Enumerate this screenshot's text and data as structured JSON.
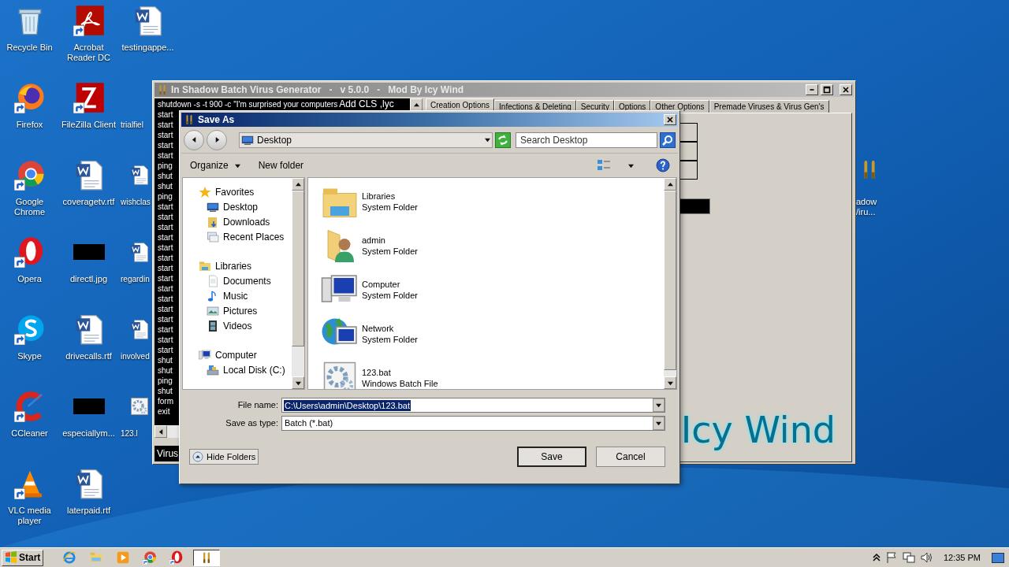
{
  "desktop_icons": [
    {
      "label": "Recycle Bin",
      "kind": "recycle"
    },
    {
      "label": "Firefox",
      "kind": "firefox"
    },
    {
      "label": "Google Chrome",
      "kind": "chrome"
    },
    {
      "label": "Opera",
      "kind": "opera"
    },
    {
      "label": "Skype",
      "kind": "skype"
    },
    {
      "label": "CCleaner",
      "kind": "ccleaner"
    },
    {
      "label": "VLC media player",
      "kind": "vlc"
    },
    {
      "label": "Acrobat Reader DC",
      "kind": "pdf"
    },
    {
      "label": "FileZilla Client",
      "kind": "filezilla"
    },
    {
      "label": "coveragetv.rtf",
      "kind": "word"
    },
    {
      "label": "directl.jpg",
      "kind": "image"
    },
    {
      "label": "drivecalls.rtf",
      "kind": "word"
    },
    {
      "label": "especiallym...",
      "kind": "image"
    },
    {
      "label": "laterpaid.rtf",
      "kind": "word"
    },
    {
      "label": "testingappe...",
      "kind": "word"
    },
    {
      "label": "trialfiel",
      "kind": "none"
    },
    {
      "label": "wishclas",
      "kind": "word"
    },
    {
      "label": "regardin",
      "kind": "word"
    },
    {
      "label": "involved",
      "kind": "word"
    },
    {
      "label": "123.l",
      "kind": "batch"
    }
  ],
  "side_icon": {
    "label": "adow /iru...",
    "kind": "bullets"
  },
  "app_window": {
    "title": "In Shadow Batch Virus Generator   -   v 5.0.0   -   Mod By Icy Wind",
    "active": false,
    "code_lines": [
      "shutdown -s -t 900 -c \"I'm surprised your computers",
      "start",
      "start",
      "start",
      "start",
      "start",
      "ping",
      "shut",
      "shut",
      "ping",
      "start",
      "start",
      "start",
      "start",
      "start",
      "start",
      "start",
      "start",
      "start",
      "start",
      "start",
      "start",
      "start",
      "start",
      "start",
      "shut",
      "shut",
      "ping",
      "shut",
      "form",
      "exit"
    ],
    "overlay_label": "Add CLS ,lyc",
    "status_label": "Virus",
    "tabs": [
      {
        "label": "Creation Options",
        "selected": true
      },
      {
        "label": "Infections & Deleting",
        "selected": false
      },
      {
        "label": "Security",
        "selected": false
      },
      {
        "label": "Options",
        "selected": false
      },
      {
        "label": "Other Options",
        "selected": false
      },
      {
        "label": "Premade Viruses & Virus Gen's",
        "selected": false
      }
    ],
    "logo_text": "Icy Wind"
  },
  "dialog": {
    "title": "Save As",
    "active": true,
    "address": "Desktop",
    "search_placeholder": "Search Desktop",
    "toolbar": {
      "organize": "Organize",
      "new_folder": "New folder"
    },
    "nav": [
      {
        "label": "Favorites",
        "kind": "star",
        "children": [
          {
            "label": "Desktop",
            "kind": "desktop"
          },
          {
            "label": "Downloads",
            "kind": "downloads"
          },
          {
            "label": "Recent Places",
            "kind": "recent"
          }
        ]
      },
      {
        "label": "Libraries",
        "kind": "library",
        "children": [
          {
            "label": "Documents",
            "kind": "document"
          },
          {
            "label": "Music",
            "kind": "music"
          },
          {
            "label": "Pictures",
            "kind": "pictures"
          },
          {
            "label": "Videos",
            "kind": "videos"
          }
        ]
      },
      {
        "label": "Computer",
        "kind": "computer",
        "children": [
          {
            "label": "Local Disk (C:)",
            "kind": "disk"
          }
        ]
      }
    ],
    "items": [
      {
        "name": "Libraries",
        "type": "System Folder",
        "kind": "libraries"
      },
      {
        "name": "admin",
        "type": "System Folder",
        "kind": "user"
      },
      {
        "name": "Computer",
        "type": "System Folder",
        "kind": "computer"
      },
      {
        "name": "Network",
        "type": "System Folder",
        "kind": "network"
      },
      {
        "name": "123.bat",
        "type": "Windows Batch File",
        "kind": "batch"
      }
    ],
    "file_name_label": "File name:",
    "file_name": "C:\\Users\\admin\\Desktop\\123.bat",
    "file_name_selected": true,
    "type_label": "Save as type:",
    "type_value": "Batch (*.bat)",
    "hide_folders": "Hide Folders",
    "save": "Save",
    "cancel": "Cancel"
  },
  "taskbar": {
    "start": "Start",
    "pinned": [
      {
        "kind": "ie",
        "active": false
      },
      {
        "kind": "explorer",
        "active": false
      },
      {
        "kind": "media",
        "active": false
      },
      {
        "kind": "chrome",
        "active": false
      },
      {
        "kind": "opera",
        "active": false
      },
      {
        "kind": "bullets",
        "active": true
      }
    ],
    "clock": "12:35 PM"
  }
}
